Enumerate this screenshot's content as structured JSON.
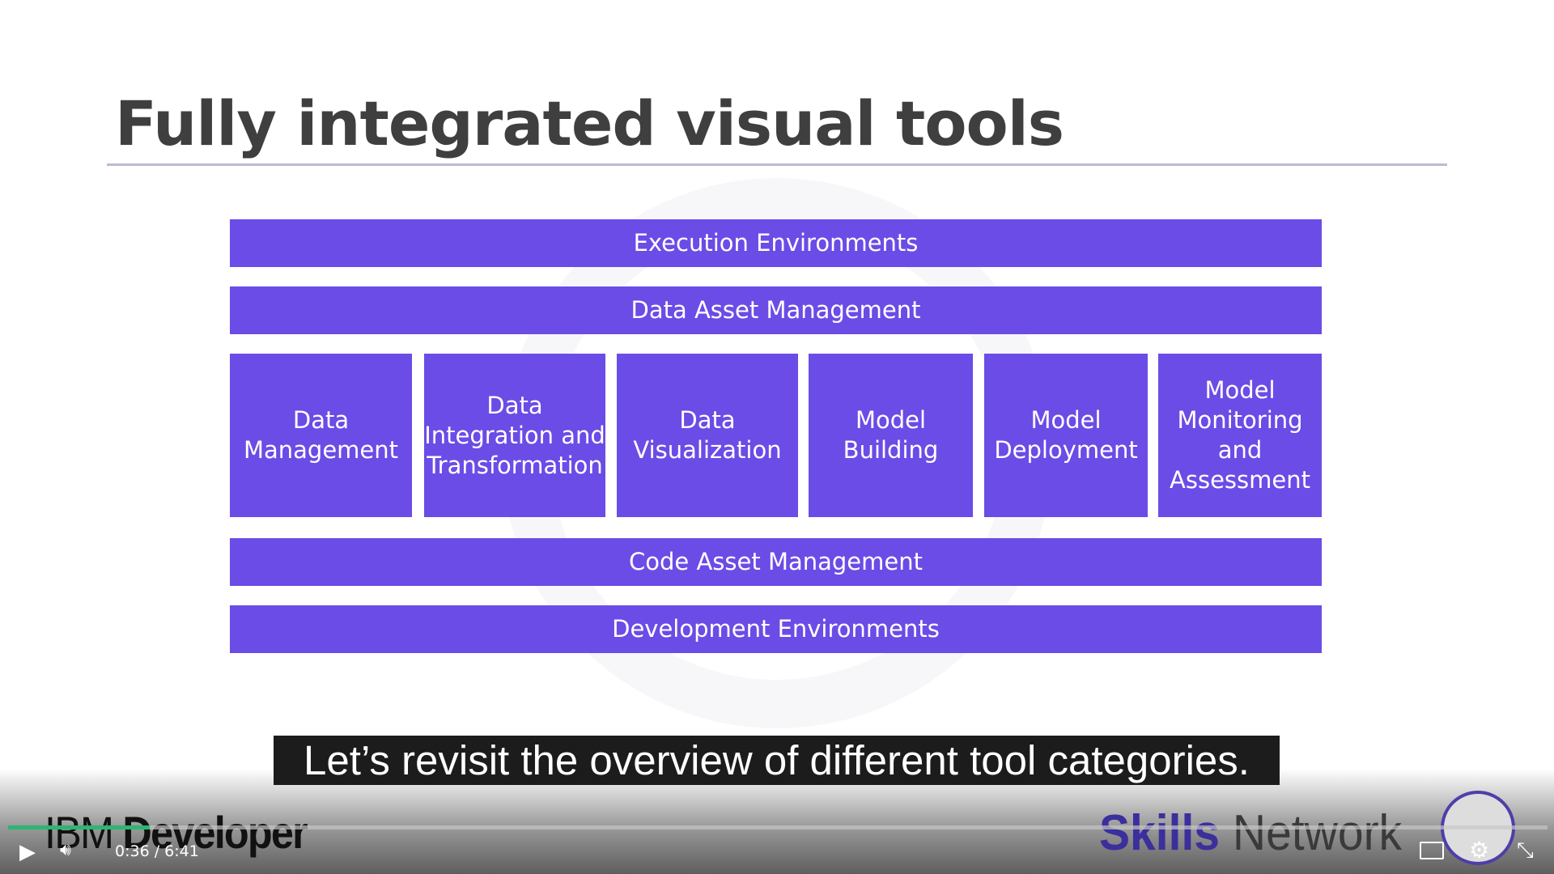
{
  "slide": {
    "title": "Fully integrated visual tools",
    "bars_top": [
      "Execution Environments",
      "Data Asset Management"
    ],
    "boxes": [
      "Data Management",
      "Data Integration and Transformation",
      "Data Visualization",
      "Model Building",
      "Model Deployment",
      "Model Monitoring and Assessment"
    ],
    "bars_bottom": [
      "Code Asset Management",
      "Development Environments"
    ],
    "accent": "#6b4ce6"
  },
  "caption": "Let’s revisit the overview of different tool categories.",
  "logos": {
    "left_a": "IBM",
    "left_b": "Developer",
    "right_a": "Skills",
    "right_b": " Network"
  },
  "player": {
    "current_time": "0:36",
    "separator": "/",
    "duration": "6:41",
    "progress_percent": 9.2,
    "progress_color": "#2bb673"
  }
}
